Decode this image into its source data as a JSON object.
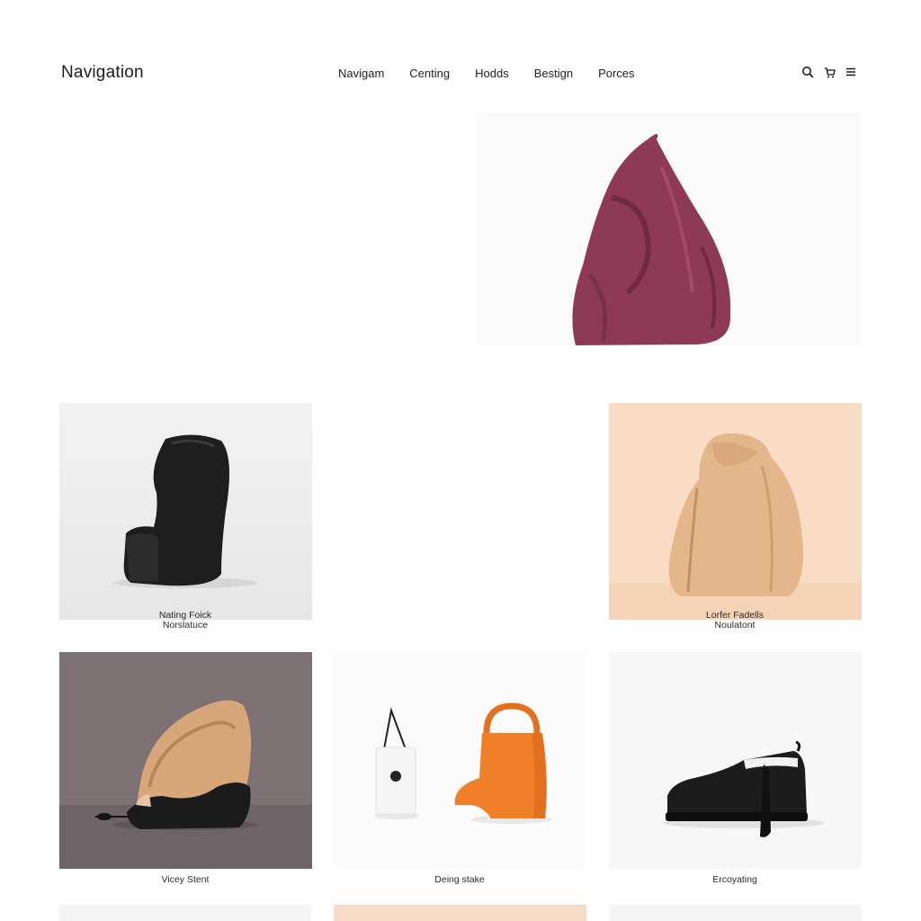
{
  "header": {
    "brand": "Navigation",
    "nav": [
      "Navigam",
      "Centing",
      "Hodds",
      "Bestign",
      "Porces"
    ],
    "icons": [
      "search-icon",
      "cart-icon",
      "menu-icon"
    ]
  },
  "products": [
    {
      "id": "scarf",
      "caption_line1": "",
      "caption_line2": ""
    },
    {
      "id": "chair",
      "caption_line1": "Nating Foick",
      "caption_line2": "Norslatuce"
    },
    {
      "id": "bag",
      "caption_line1": "Lorfer Fadells",
      "caption_line2": "Noulatont"
    },
    {
      "id": "pod",
      "caption_line1": "Vicey Stent",
      "caption_line2": ""
    },
    {
      "id": "totes",
      "caption_line1": "Deing stake",
      "caption_line2": ""
    },
    {
      "id": "shoe",
      "caption_line1": "Ercoyating",
      "caption_line2": ""
    }
  ],
  "colors": {
    "scarf": "#8e3a56",
    "chair_bg": "#f0f0f0",
    "bag_bg": "#f8dcc3",
    "bag": "#e3b68c",
    "pod_bg": "#7d7174",
    "pod_shell": "#d7a77a",
    "orange_bag": "#f07f2a"
  }
}
